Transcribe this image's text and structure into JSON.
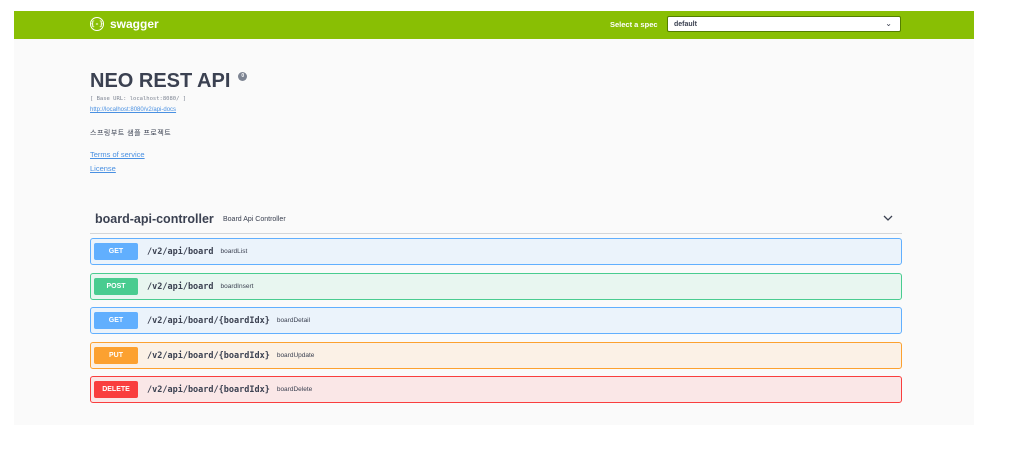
{
  "topbar": {
    "logo_text": "swagger",
    "logo_glyph": "{-}",
    "spec_label": "Select a spec",
    "spec_selected": "default",
    "color": "#89bf04"
  },
  "info": {
    "title": "NEO REST API",
    "version_badge": "0",
    "base_url": "[ Base URL: localhost:8080/ ]",
    "docs_link": "http://localhost:8080/v2/api-docs",
    "description": "스프링부트 샘플 프로젝트",
    "terms_of_service": "Terms of service",
    "license": "License"
  },
  "tag": {
    "name": "board-api-controller",
    "description": "Board Api Controller"
  },
  "operations": [
    {
      "method": "GET",
      "path": "/v2/api/board",
      "summary": "boardList",
      "color": "#61affe"
    },
    {
      "method": "POST",
      "path": "/v2/api/board",
      "summary": "boardInsert",
      "color": "#49cc90"
    },
    {
      "method": "GET",
      "path": "/v2/api/board/{boardIdx}",
      "summary": "boardDetail",
      "color": "#61affe"
    },
    {
      "method": "PUT",
      "path": "/v2/api/board/{boardIdx}",
      "summary": "boardUpdate",
      "color": "#fca130"
    },
    {
      "method": "DELETE",
      "path": "/v2/api/board/{boardIdx}",
      "summary": "boardDelete",
      "color": "#f93e3e"
    }
  ]
}
